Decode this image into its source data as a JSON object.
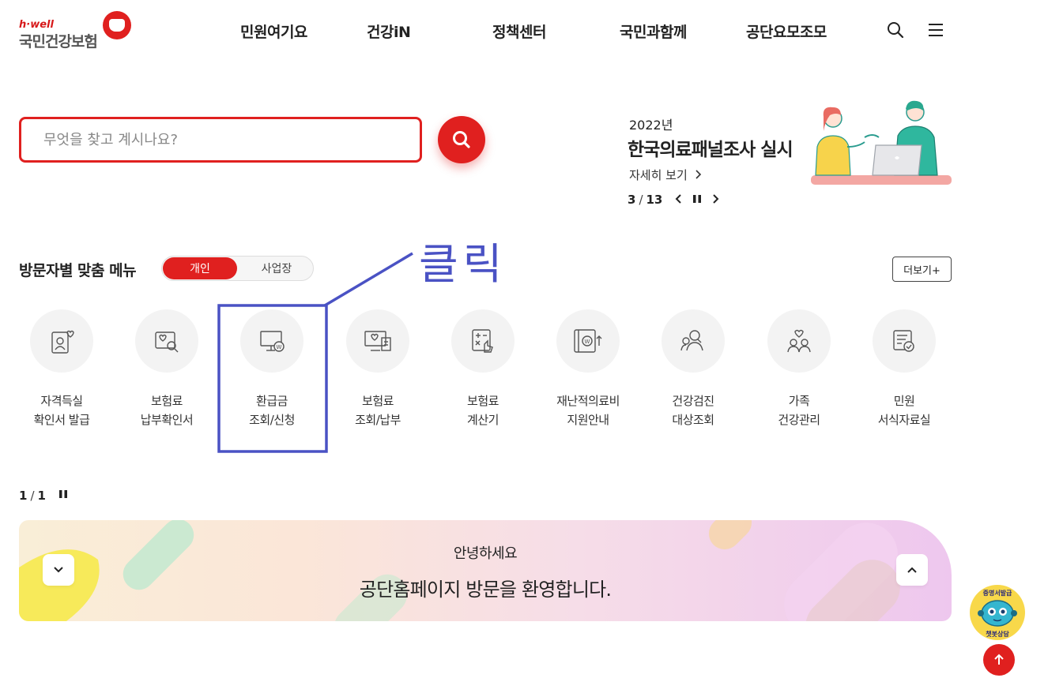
{
  "logo": {
    "brand": "h·well",
    "name": "국민건강보험"
  },
  "gnb": [
    "민원여기요",
    "건강iN",
    "정책센터",
    "국민과함께",
    "공단요모조모"
  ],
  "header_icons": {
    "search": "search-icon",
    "menu": "hamburger-icon"
  },
  "search": {
    "placeholder": "무엇을 찾고 계시나요?",
    "value": ""
  },
  "banner": {
    "year": "2022년",
    "title": "한국의료패널조사 실시",
    "more": "자세히 보기",
    "current": "3",
    "total": "13"
  },
  "annotation": {
    "text": "클릭",
    "color": "#4a52c4"
  },
  "menu_section": {
    "title": "방문자별 맞춤 메뉴",
    "tabs": [
      "개인",
      "사업장"
    ],
    "active_tab": "개인",
    "more": "더보기+",
    "items": [
      {
        "line1": "자격득실",
        "line2": "확인서 발급",
        "icon": "id-card-heart-icon"
      },
      {
        "line1": "보험료",
        "line2": "납부확인서",
        "icon": "document-search-icon"
      },
      {
        "line1": "환급금",
        "line2": "조회/신청",
        "icon": "monitor-won-icon"
      },
      {
        "line1": "보험료",
        "line2": "조회/납부",
        "icon": "monitor-receipt-icon"
      },
      {
        "line1": "보험료",
        "line2": "계산기",
        "icon": "calculator-icon"
      },
      {
        "line1": "재난적의료비",
        "line2": "지원안내",
        "icon": "won-support-icon"
      },
      {
        "line1": "건강검진",
        "line2": "대상조회",
        "icon": "people-search-icon"
      },
      {
        "line1": "가족",
        "line2": "건강관리",
        "icon": "family-heart-icon"
      },
      {
        "line1": "민원",
        "line2": "서식자료실",
        "icon": "form-check-icon"
      }
    ],
    "pager": {
      "current": "1",
      "total": "1"
    }
  },
  "welcome": {
    "sub": "안녕하세요",
    "main": "공단홈페이지 방문을 환영합니다."
  },
  "chatbot": {
    "top_text": "증명서발급",
    "bottom_text": "챗봇상담"
  },
  "colors": {
    "brand_red": "#e0201f",
    "annotation_blue": "#4a52c4"
  }
}
